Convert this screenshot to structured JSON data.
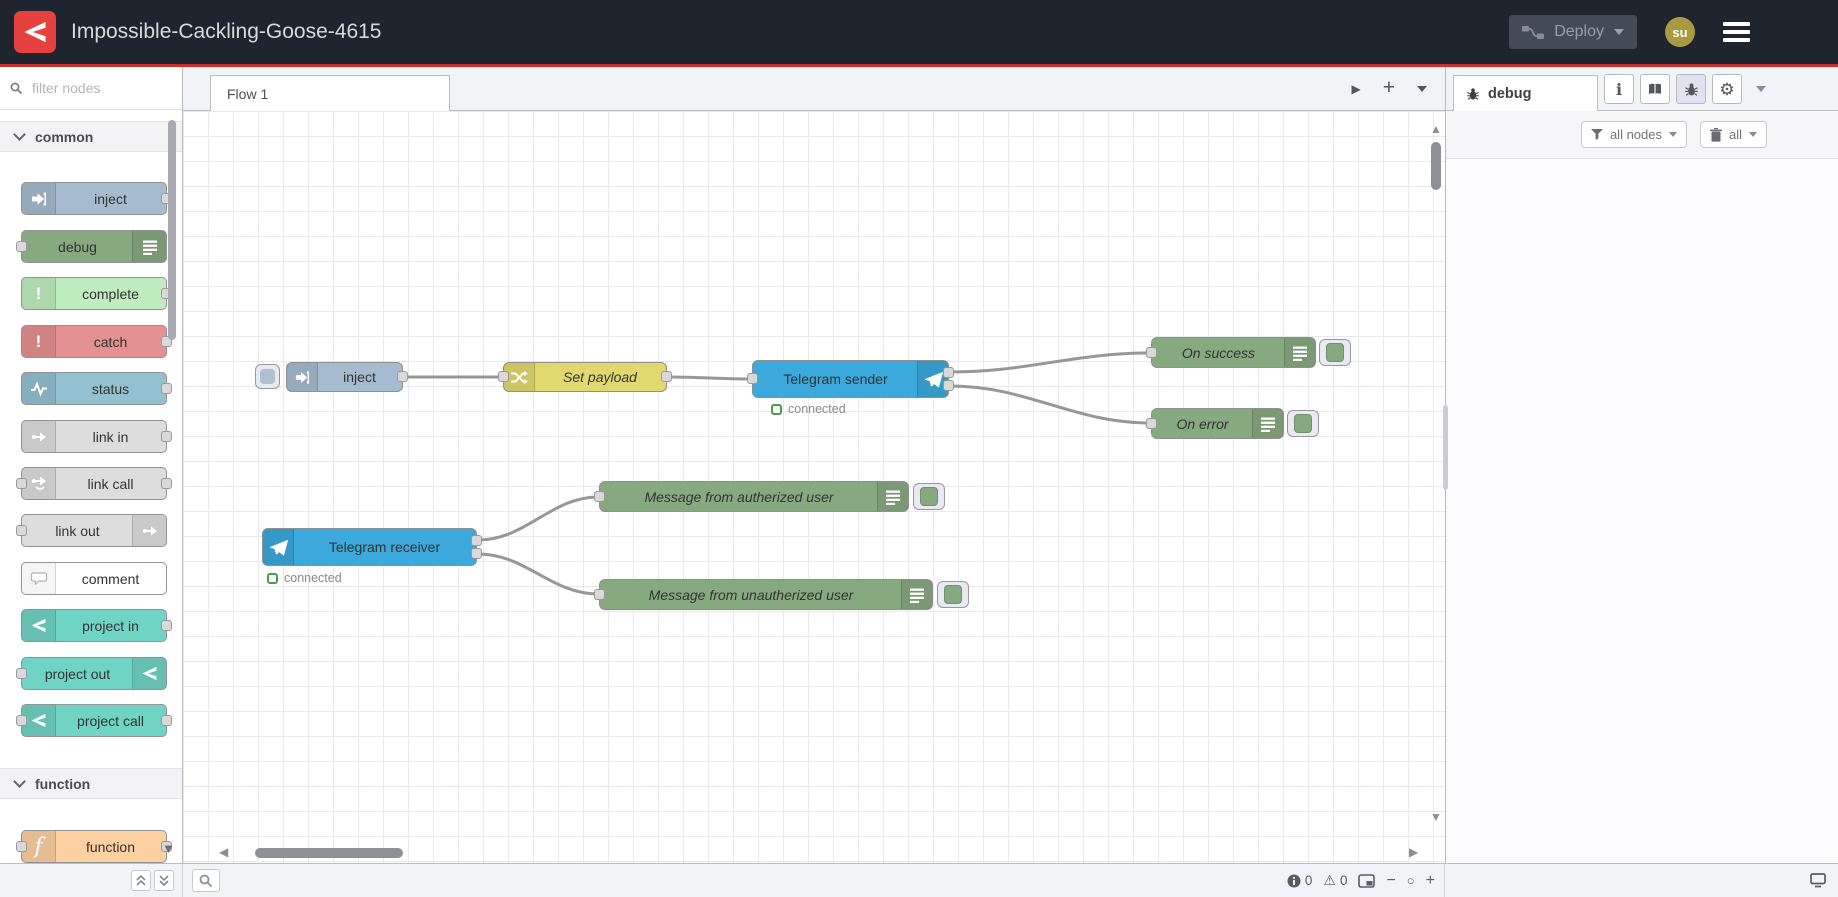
{
  "colors": {
    "accent_red": "#c9302c",
    "header_bg": "#1f252e",
    "wire": "#979797",
    "status_green": "#4d9a53",
    "selected_tool_bg": "#e2e2ee"
  },
  "header": {
    "title": "Impossible-Cackling-Goose-4615",
    "deploy": {
      "label": "Deploy"
    },
    "user": {
      "initials": "su"
    }
  },
  "palette": {
    "filter_placeholder": "filter nodes",
    "categories": [
      {
        "label": "common"
      },
      {
        "label": "function"
      }
    ],
    "items": [
      {
        "label": "inject",
        "color": "#a6bbcf",
        "icon": "inject-arrow-icon"
      },
      {
        "label": "debug",
        "color": "#87a980",
        "icon": "debug-list-icon"
      },
      {
        "label": "complete",
        "color": "#c0edc0",
        "icon": "exclamation-icon"
      },
      {
        "label": "catch",
        "color": "#e49191",
        "icon": "exclamation-icon"
      },
      {
        "label": "status",
        "color": "#94c1d0",
        "icon": "pulse-icon"
      },
      {
        "label": "link in",
        "color": "#dddddd",
        "icon": "link-icon"
      },
      {
        "label": "link call",
        "color": "#dddddd",
        "icon": "link-icon"
      },
      {
        "label": "link out",
        "color": "#dddddd",
        "icon": "link-icon"
      },
      {
        "label": "comment",
        "color": "#ffffff",
        "icon": "comment-bubble-icon"
      },
      {
        "label": "project in",
        "color": "#6fd4c3",
        "icon": "node-red-icon"
      },
      {
        "label": "project out",
        "color": "#6fd4c3",
        "icon": "node-red-icon"
      },
      {
        "label": "project call",
        "color": "#6fd4c3",
        "icon": "node-red-icon"
      },
      {
        "label": "function",
        "color": "#fdd0a2",
        "icon": "function-f-icon"
      }
    ]
  },
  "workspace": {
    "active_tab": "Flow 1"
  },
  "flow": {
    "nodes": [
      {
        "label": "inject",
        "color": "#a6bbcf"
      },
      {
        "label": "Set payload",
        "color": "#e2d96e"
      },
      {
        "label": "Telegram sender",
        "color": "#3ba9db",
        "status": "connected"
      },
      {
        "label": "On success",
        "color": "#87a980"
      },
      {
        "label": "On error",
        "color": "#87a980"
      },
      {
        "label": "Telegram receiver",
        "color": "#3ba9db",
        "status": "connected"
      },
      {
        "label": "Message from autherized user",
        "color": "#87a980"
      },
      {
        "label": "Message from unautherized user",
        "color": "#87a980"
      }
    ]
  },
  "sidebar": {
    "tab_label": "debug",
    "filter_button": "all nodes",
    "clear_button": "all"
  },
  "footer": {
    "info_count": "0",
    "warning_count": "0"
  }
}
